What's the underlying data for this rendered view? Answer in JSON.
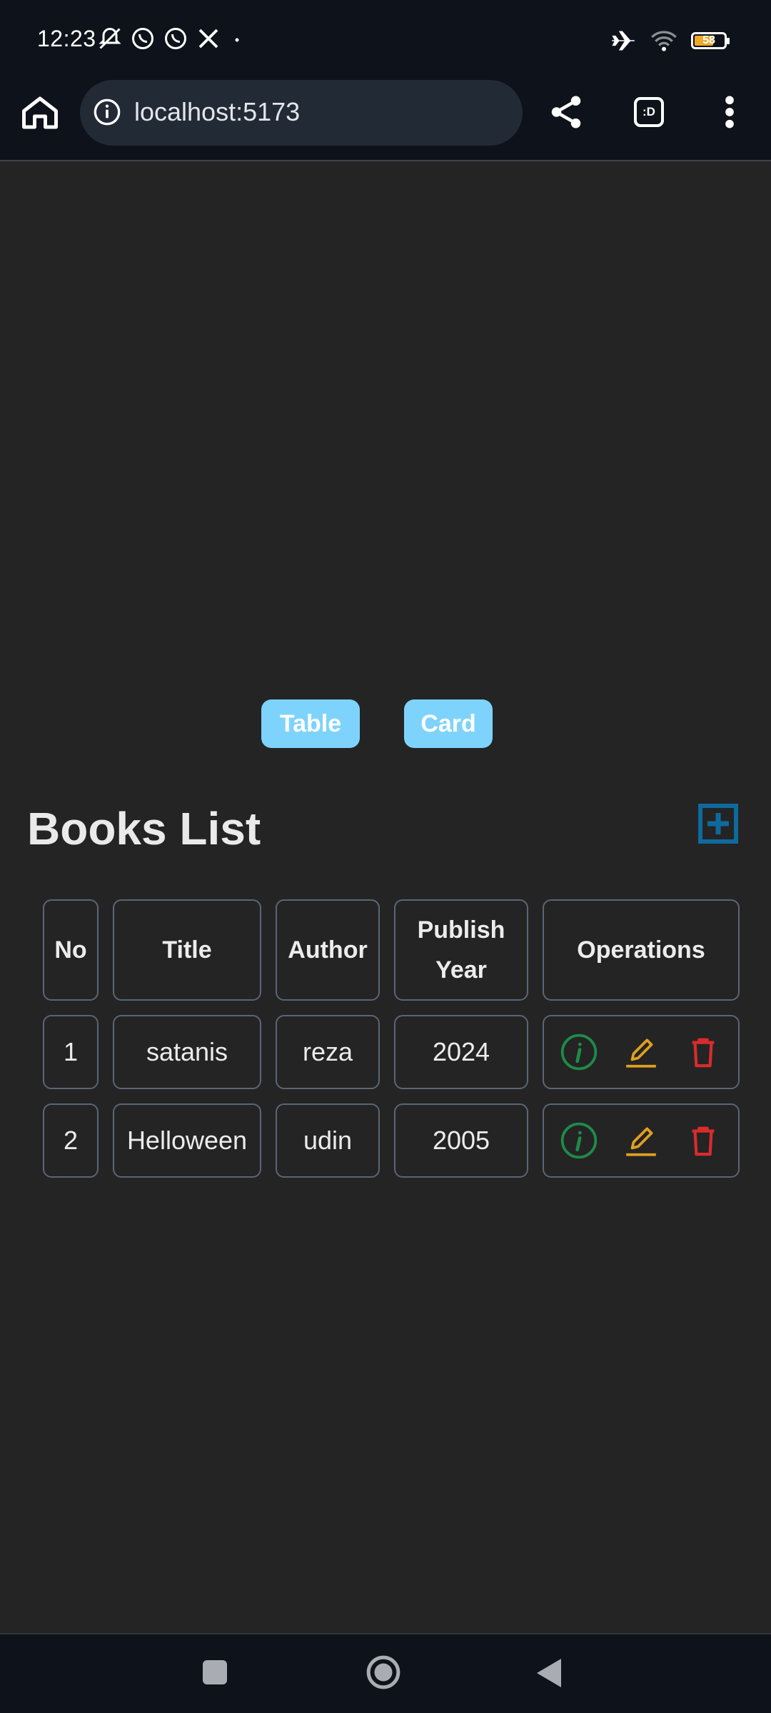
{
  "status_bar": {
    "time": "12:23",
    "battery": "58"
  },
  "browser": {
    "url": "localhost:5173",
    "tabs_label": ":D"
  },
  "view_toggle": {
    "table_label": "Table",
    "card_label": "Card"
  },
  "page": {
    "title": "Books List"
  },
  "table": {
    "headers": {
      "no": "No",
      "title": "Title",
      "author": "Author",
      "publish_year_line1": "Publish",
      "publish_year_line2": "Year",
      "operations": "Operations"
    },
    "rows": [
      {
        "no": "1",
        "title": "satanis",
        "author": "reza",
        "year": "2024"
      },
      {
        "no": "2",
        "title": "Helloween",
        "author": "udin",
        "year": "2005"
      }
    ]
  },
  "colors": {
    "accent_button": "#7dd3fc",
    "add_icon": "#0e6a9e",
    "info_icon": "#1f8a4a",
    "edit_icon": "#e0a020",
    "delete_icon": "#d82c2c",
    "background": "#242424",
    "chrome": "#0e121a"
  },
  "icons": [
    "home-icon",
    "info-icon",
    "share-icon",
    "tabs-icon",
    "menu-icon",
    "add-box-icon",
    "info-circle-icon",
    "pencil-icon",
    "trash-icon"
  ]
}
